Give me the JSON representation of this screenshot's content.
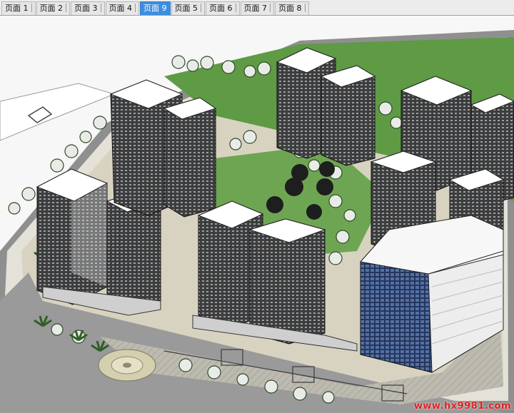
{
  "tabs": [
    {
      "label": "页面 1",
      "active": false
    },
    {
      "label": "页面 2",
      "active": false
    },
    {
      "label": "页面 3",
      "active": false
    },
    {
      "label": "页面 4",
      "active": false
    },
    {
      "label": "页面 9",
      "active": true
    },
    {
      "label": "页面 5",
      "active": false
    },
    {
      "label": "页面 6",
      "active": false
    },
    {
      "label": "页面 7",
      "active": false
    },
    {
      "label": "页面 8",
      "active": false
    }
  ],
  "viewport": {
    "watermark": "www.hx9981.com",
    "colors": {
      "lawn": "#5f9a45",
      "plaza": "#d9d4c2",
      "road": "#8e8e8e",
      "roof": "#ffffff",
      "facade": "#3a3a3a",
      "glass_tower": "#2c3e66",
      "watermark": "#e0201a"
    }
  }
}
